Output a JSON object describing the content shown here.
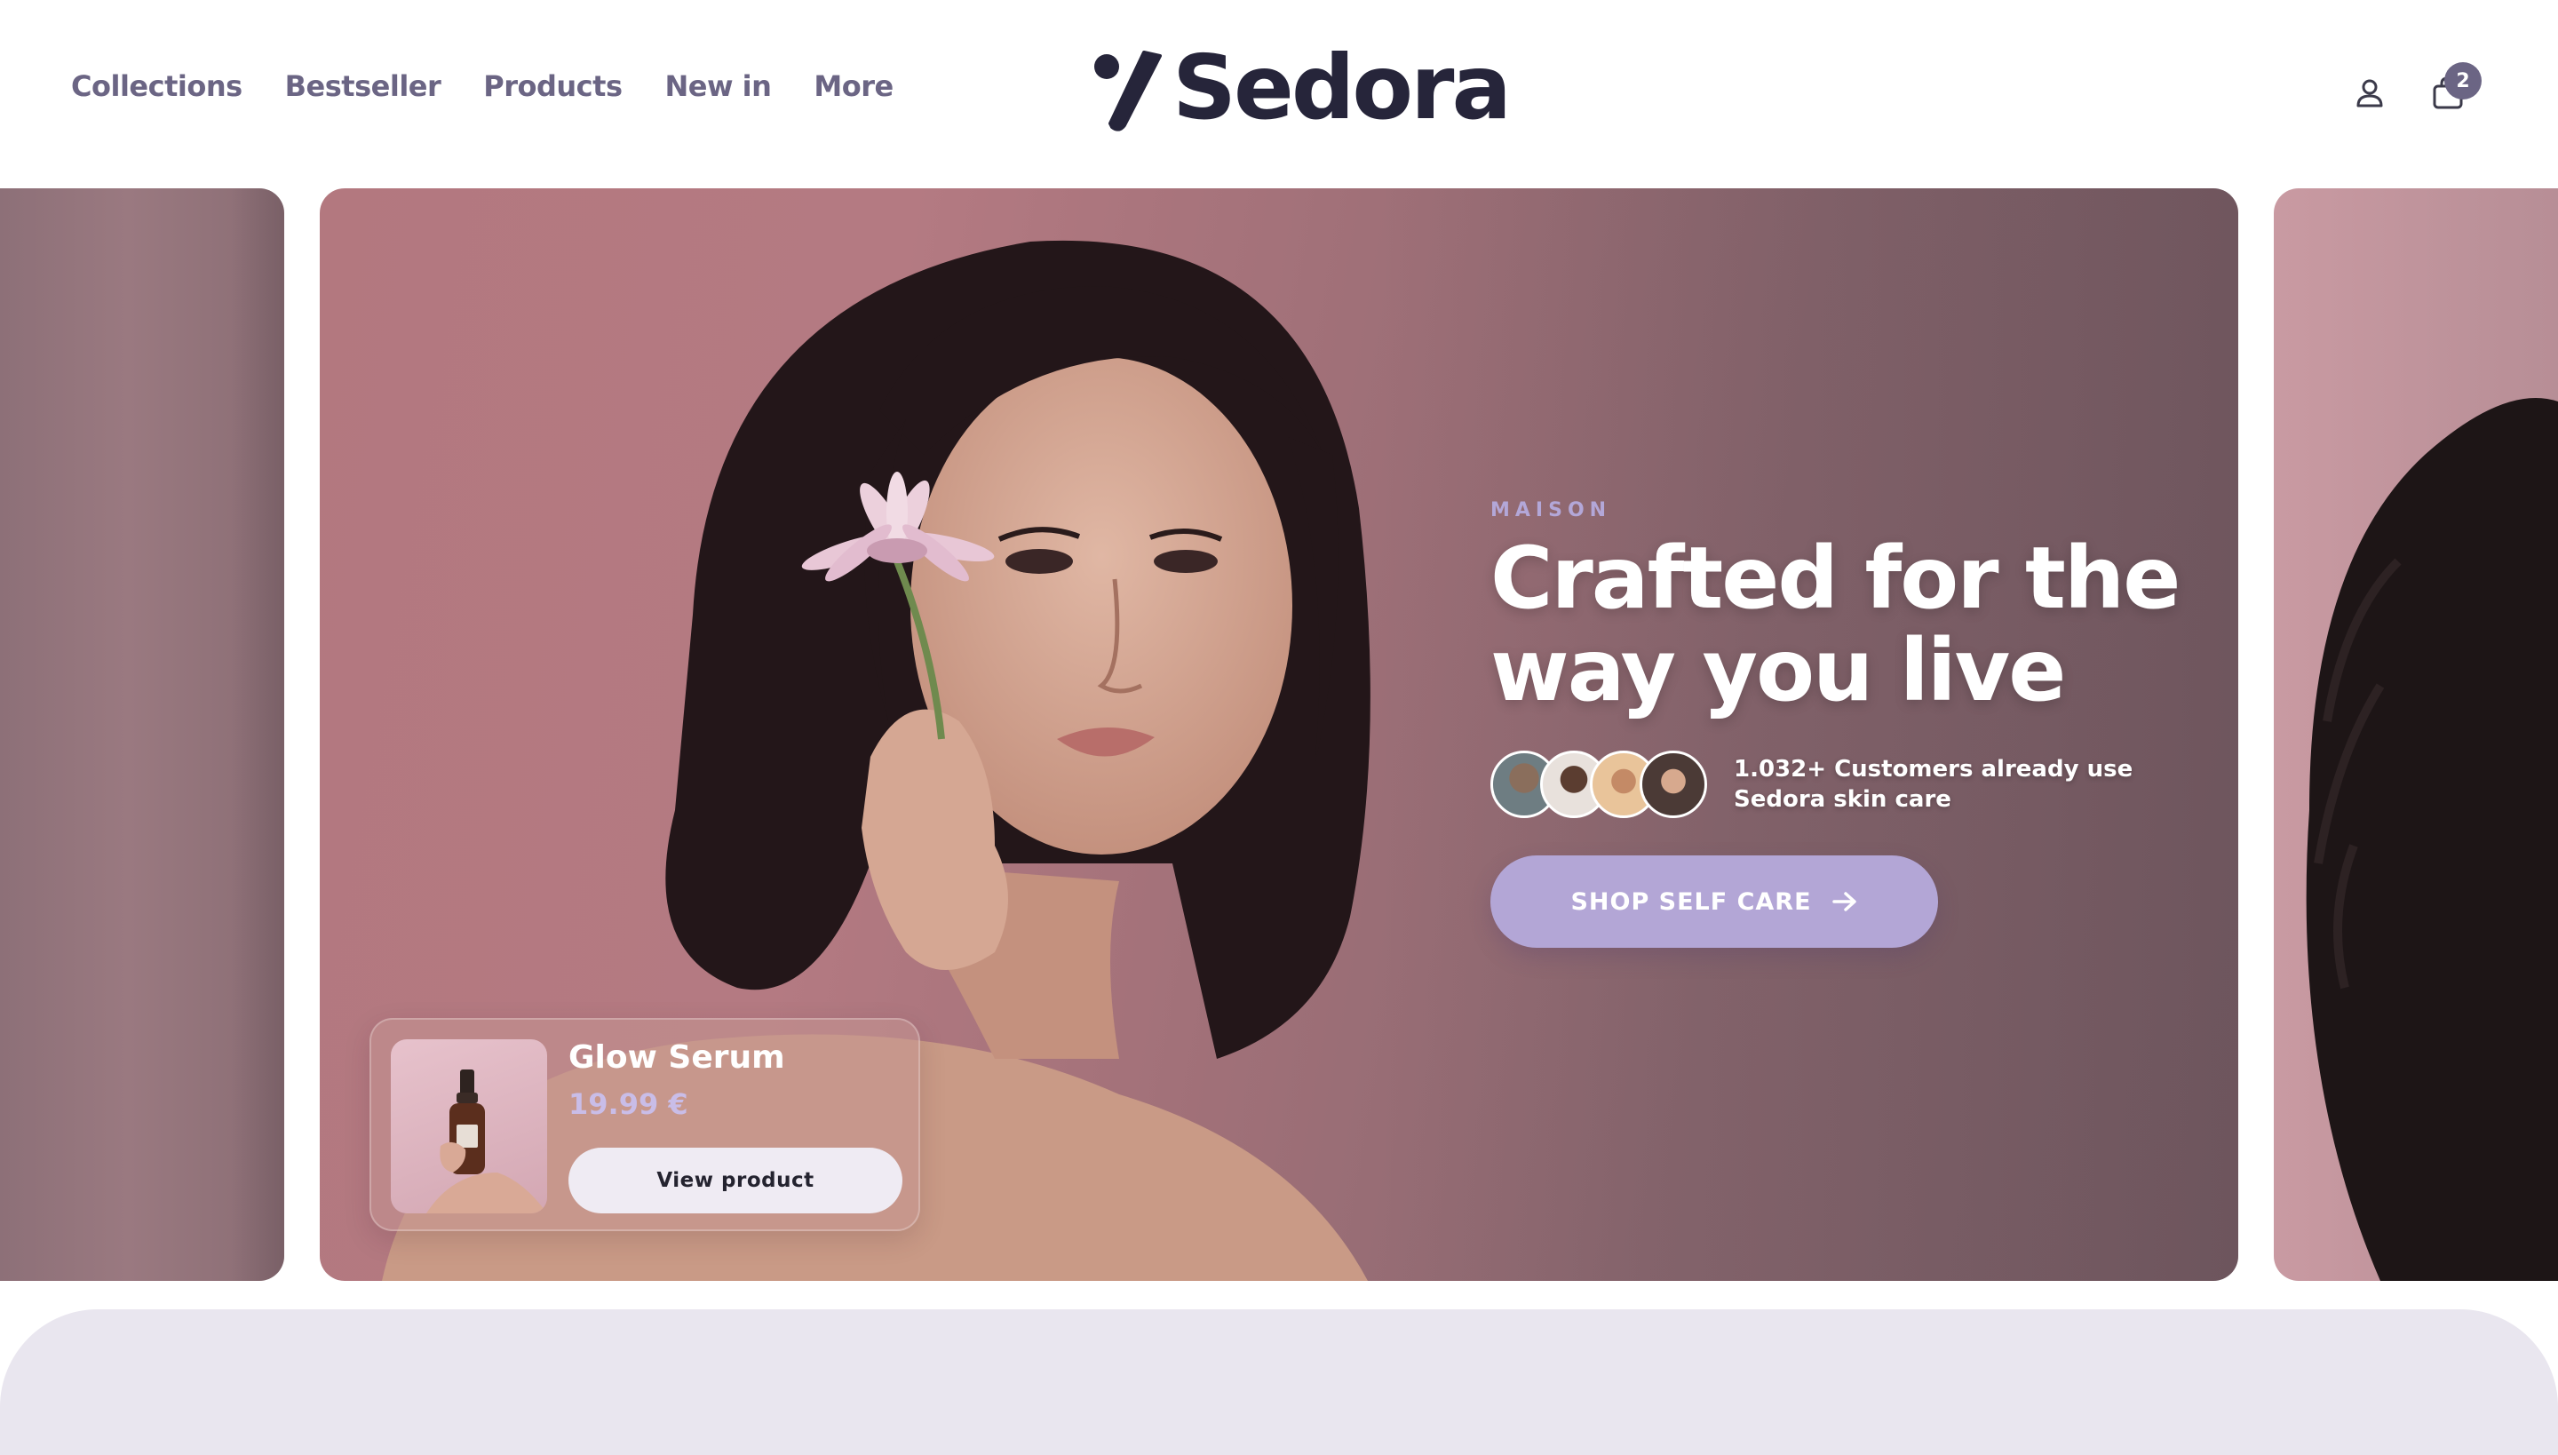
{
  "header": {
    "nav": [
      "Collections",
      "Bestseller",
      "Products",
      "New in",
      "More"
    ],
    "brand": "Sedora",
    "cart_count": "2",
    "icons": {
      "account": "user-icon",
      "cart": "shopping-bag-icon"
    }
  },
  "hero": {
    "eyebrow": "MAISON",
    "headline_line1": "Crafted for the",
    "headline_line2": "way you live",
    "social_proof": "1.032+ Customers already use Sedora skin care",
    "cta_label": "SHOP SELF CARE",
    "cta_icon": "arrow-right-icon"
  },
  "product_card": {
    "name": "Glow Serum",
    "price": "19.99 €",
    "button_label": "View product"
  },
  "colors": {
    "nav_text": "#6b6584",
    "brand_text": "#26253a",
    "accent": "#b3a6d6",
    "eyebrow": "#b3a7d8",
    "panel": "#e9e6ef"
  }
}
